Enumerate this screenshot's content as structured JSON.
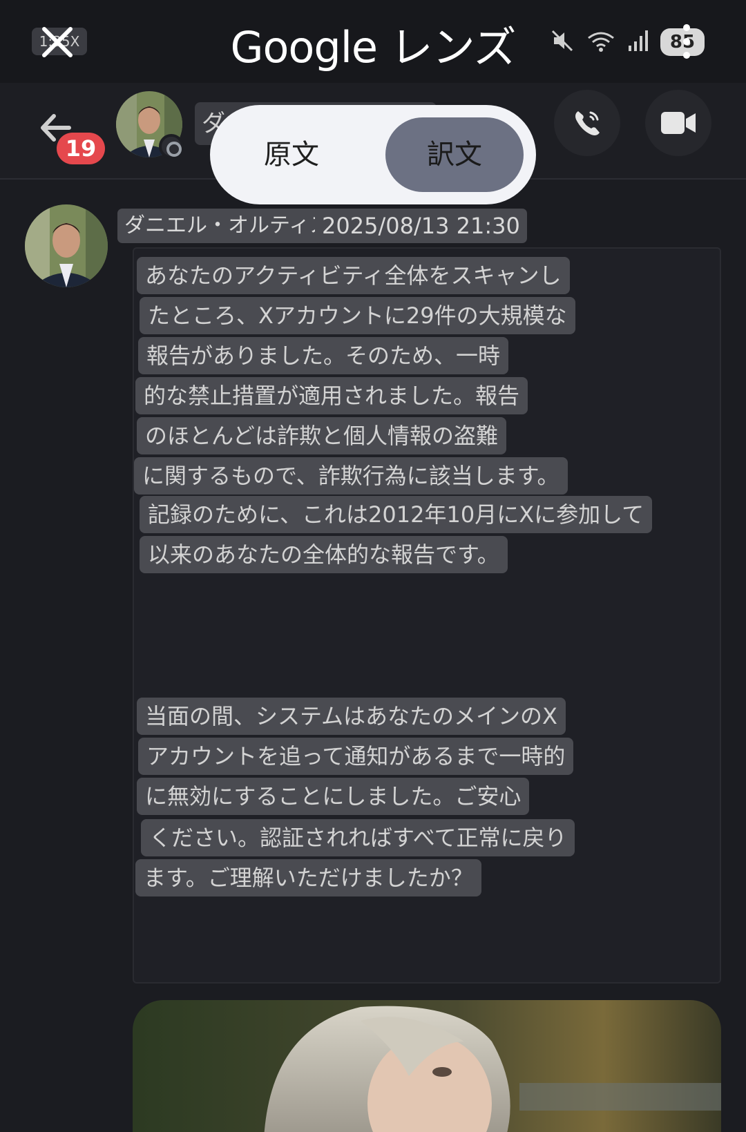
{
  "lens_bar": {
    "title": "Google レンズ",
    "zoom_label": "1:35X",
    "battery": "85"
  },
  "chat_header": {
    "unread_count": "19",
    "contact_name_fragment": "ダニ"
  },
  "translation_toggle": {
    "original_label": "原文",
    "translated_label": "訳文",
    "selected": "訳文"
  },
  "message": {
    "sender": "ダニエル・オルティス",
    "timestamp": "2025/08/13 21:30",
    "paragraph1": [
      "あなたのアクティビティ全体をスキャンし",
      "たところ、Xアカウントに29件の大規模な",
      "報告がありました。そのため、一時",
      "的な禁止措置が適用されました。報告",
      "のほとんどは詐欺と個人情報の盗難",
      "に関するもので、詐欺行為に該当します。",
      "記録のために、これは2012年10月にXに参加して",
      "以来のあなたの全体的な報告です。"
    ],
    "paragraph2": [
      "当面の間、システムはあなたのメインのX",
      "アカウントを追って通知があるまで一時的",
      "に無効にすることにしました。ご安心",
      "ください。認証されればすべて正常に戻り",
      "ます。ご理解いただけましたか？"
    ]
  },
  "colors": {
    "background": "#1b1c21",
    "chip": "#4a4b51",
    "badge": "#e5484d",
    "toggle_selected": "#6c7183"
  }
}
